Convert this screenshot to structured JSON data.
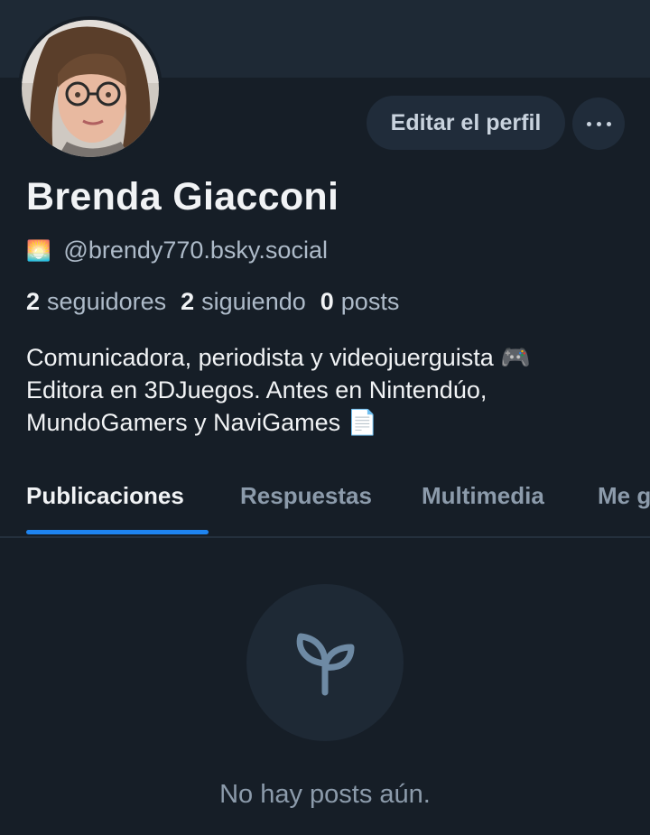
{
  "profile": {
    "name": "Brenda Giacconi",
    "handle_emoji": "🌅",
    "handle": "@brendy770.bsky.social",
    "edit_button_label": "Editar el perfil",
    "more_button_icon": "ellipsis-icon",
    "stats": [
      {
        "count": "2",
        "label": "seguidores"
      },
      {
        "count": "2",
        "label": "siguiendo"
      },
      {
        "count": "0",
        "label": "posts"
      }
    ],
    "bio_lines": [
      "Comunicadora, periodista y videojuerguista 🎮",
      "Editora en 3DJuegos. Antes en Nintendúo,",
      "MundoGamers y NaviGames 📄"
    ]
  },
  "tabs": [
    {
      "label": "Publicaciones",
      "active": true
    },
    {
      "label": "Respuestas",
      "active": false
    },
    {
      "label": "Multimedia",
      "active": false
    },
    {
      "label": "Me gusta",
      "active": false
    }
  ],
  "empty_state": {
    "icon": "sprout-icon",
    "text": "No hay posts aún."
  },
  "colors": {
    "background": "#161e27",
    "banner": "#1e2935",
    "accent": "#1e84f0",
    "muted_text": "#aebbc9"
  }
}
